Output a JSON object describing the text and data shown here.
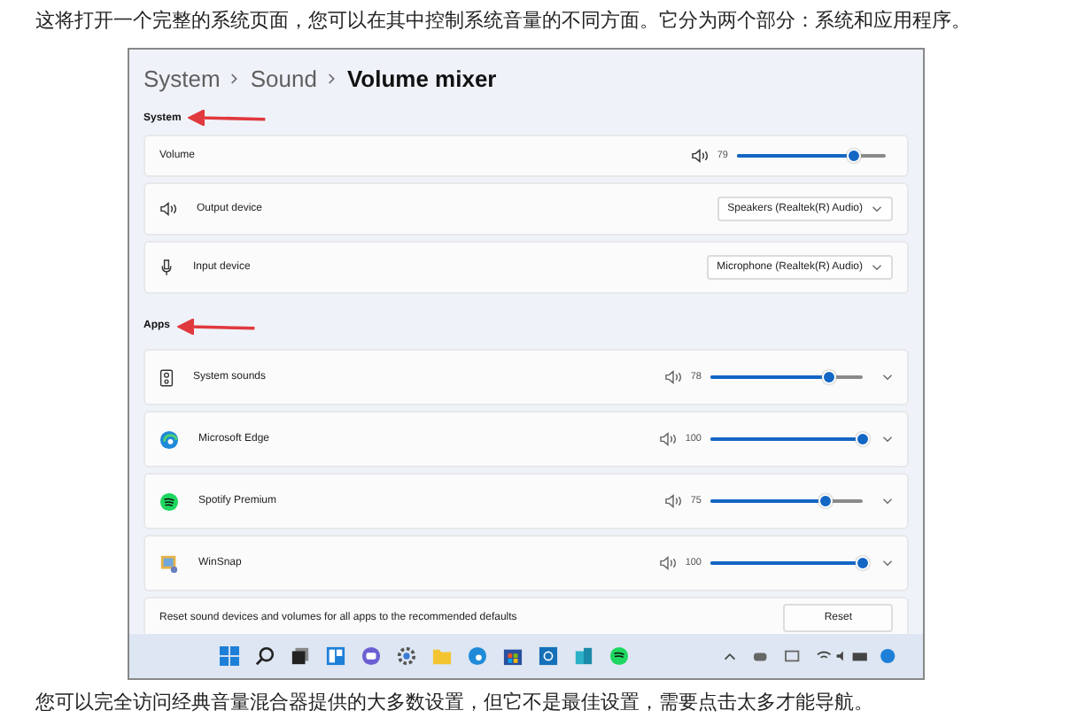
{
  "intro": "这将打开一个完整的系统页面，您可以在其中控制系统音量的不同方面。它分为两个部分：系统和应用程序。",
  "screenshot": {
    "breadcrumb": [
      "System",
      "Sound"
    ],
    "title": "Volume mixer",
    "system_label": "System",
    "volume": {
      "label": "Volume",
      "reading": "79",
      "level": 0.79
    },
    "devices": [
      {
        "kind": "output",
        "label": "Output device",
        "value": "Speakers (Realtek(R) Audio)"
      },
      {
        "kind": "input",
        "label": "Input device",
        "value": "Microphone (Realtek(R) Audio)"
      }
    ],
    "apps_label": "Apps",
    "apps": [
      {
        "kind": "system",
        "name": "System sounds",
        "reading": "78",
        "level": 0.78
      },
      {
        "kind": "edge",
        "name": "Microsoft Edge",
        "reading": "100",
        "level": 1
      },
      {
        "kind": "spotify",
        "name": "Spotify Premium",
        "reading": "75",
        "level": 0.75
      },
      {
        "kind": "winsnap",
        "name": "WinSnap",
        "reading": "100",
        "level": 1
      }
    ],
    "reset": {
      "text": "Reset sound devices and volumes for all apps to the recommended defaults",
      "button": "Reset"
    }
  },
  "outro": "您可以完全访问经典音量混合器提供的大多数设置，但它不是最佳设置，需要点击太多才能导航。"
}
